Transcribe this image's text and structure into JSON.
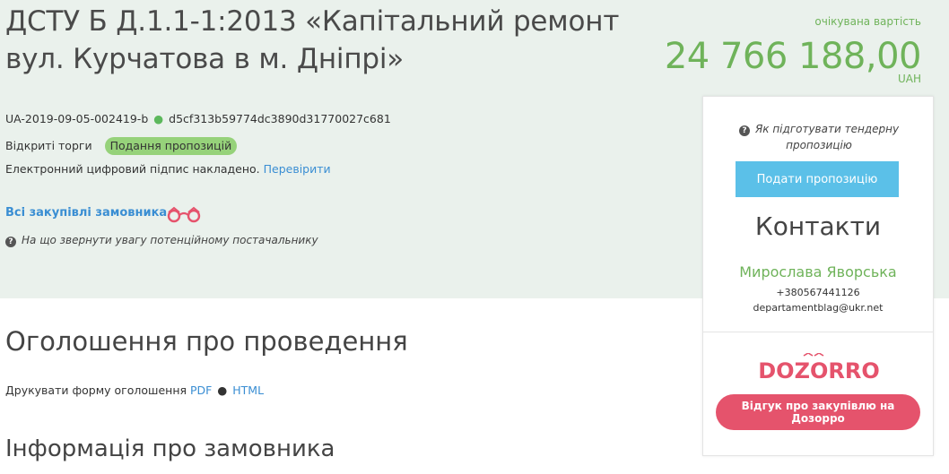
{
  "tender": {
    "title": "ДСТУ Б Д.1.1-1:2013 «Капітальний ремонт вул. Курчатова в м. Дніпрі»",
    "expected_value_label": "очікувана вартість",
    "amount": "24 766 188,00",
    "currency": "UAH",
    "id": "UA-2019-09-05-002419-b",
    "id_separator": "●",
    "hash": "d5cf313b59774dc3890d31770027c681",
    "procedure": "Відкриті торги",
    "status": "Подання пропозицій",
    "signature_text": "Електронний цифровий підпис накладено.",
    "signature_link": "Перевірити",
    "all_buyer_link": "Всі закупівлі замовника",
    "supplier_hint": "На що звернути увагу потенційному постачальнику"
  },
  "sections": {
    "announcement_title": "Оголошення про проведення",
    "print_label": "Друкувати форму оголошення",
    "print_pdf": "PDF",
    "print_sep": "●",
    "print_html": "HTML",
    "buyer_title": "Інформація про замовника"
  },
  "sidebar": {
    "howto": "Як підготувати тендерну пропозицію",
    "submit_button": "Подати пропозицію",
    "contacts_title": "Контакти",
    "contact_name": "Мирослава Яворська",
    "contact_phone": "+380567441126",
    "contact_email": "departamentblag@ukr.net",
    "dozorro_logo": "DOZORRO",
    "feedback_button": "Відгук про закупівлю на Дозорро"
  },
  "icons": {
    "question": "question-circle-icon",
    "binoculars": "binoculars-icon"
  },
  "colors": {
    "hero_bg": "#eaf1ec",
    "accent_green": "#6fb35a",
    "badge_green": "#96d27a",
    "link_blue": "#3a8ed3",
    "submit_blue": "#5bc0e8",
    "dozorro_red": "#e5536c"
  }
}
